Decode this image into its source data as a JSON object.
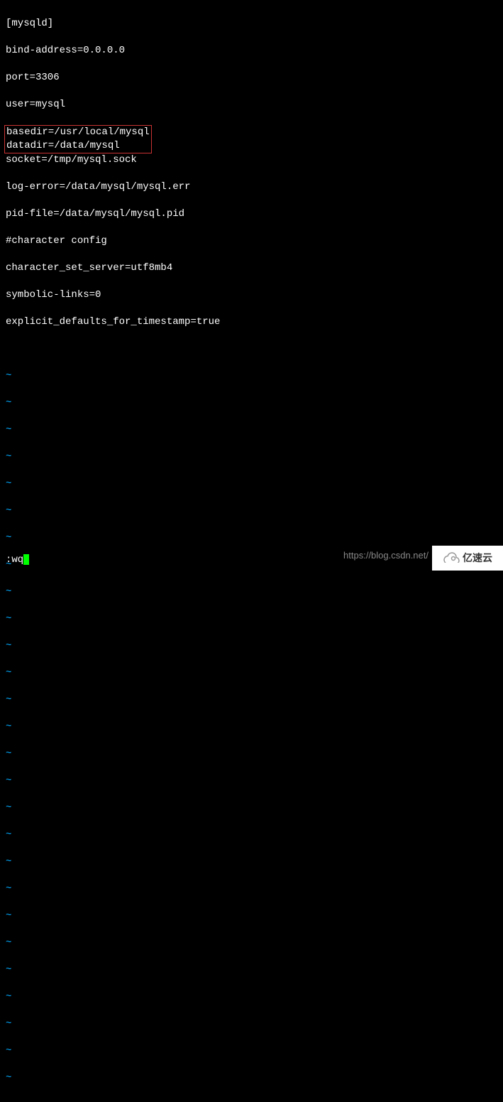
{
  "config": {
    "section": "[mysqld]",
    "lines": [
      "bind-address=0.0.0.0",
      "port=3306",
      "user=mysql"
    ],
    "highlighted": [
      "basedir=/usr/local/mysql",
      "datadir=/data/mysql"
    ],
    "lines_after": [
      "socket=/tmp/mysql.sock",
      "log-error=/data/mysql/mysql.err",
      "pid-file=/data/mysql/mysql.pid",
      "#character config",
      "character_set_server=utf8mb4",
      "symbolic-links=0",
      "explicit_defaults_for_timestamp=true"
    ]
  },
  "tilde": "~",
  "command": ":wq",
  "watermark": {
    "url": "https://blog.csdn.net/",
    "logo_text": "亿速云"
  }
}
